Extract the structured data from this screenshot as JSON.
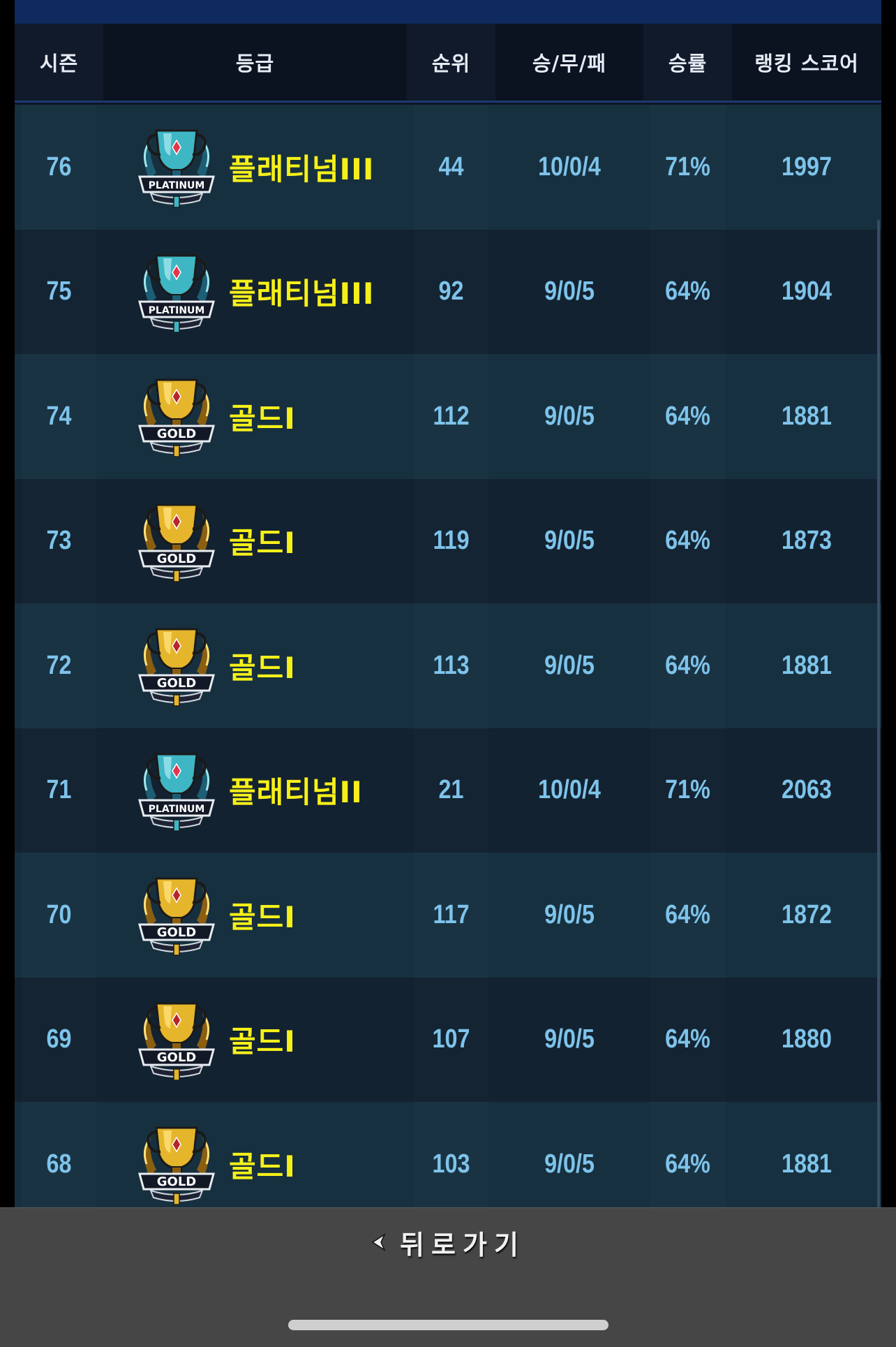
{
  "header": {
    "season": "시즌",
    "grade": "등급",
    "rank": "순위",
    "record": "승/무/패",
    "win_rate": "승률",
    "ranking_score": "랭킹 스코어"
  },
  "rows": [
    {
      "season": "76",
      "grade": "플래티넘III",
      "badge": "platinum",
      "rank": "44",
      "record": "10/0/4",
      "win_rate": "71%",
      "score": "1997"
    },
    {
      "season": "75",
      "grade": "플래티넘III",
      "badge": "platinum",
      "rank": "92",
      "record": "9/0/5",
      "win_rate": "64%",
      "score": "1904"
    },
    {
      "season": "74",
      "grade": "골드I",
      "badge": "gold",
      "rank": "112",
      "record": "9/0/5",
      "win_rate": "64%",
      "score": "1881"
    },
    {
      "season": "73",
      "grade": "골드I",
      "badge": "gold",
      "rank": "119",
      "record": "9/0/5",
      "win_rate": "64%",
      "score": "1873"
    },
    {
      "season": "72",
      "grade": "골드I",
      "badge": "gold",
      "rank": "113",
      "record": "9/0/5",
      "win_rate": "64%",
      "score": "1881"
    },
    {
      "season": "71",
      "grade": "플래티넘II",
      "badge": "platinum",
      "rank": "21",
      "record": "10/0/4",
      "win_rate": "71%",
      "score": "2063"
    },
    {
      "season": "70",
      "grade": "골드I",
      "badge": "gold",
      "rank": "117",
      "record": "9/0/5",
      "win_rate": "64%",
      "score": "1872"
    },
    {
      "season": "69",
      "grade": "골드I",
      "badge": "gold",
      "rank": "107",
      "record": "9/0/5",
      "win_rate": "64%",
      "score": "1880"
    },
    {
      "season": "68",
      "grade": "골드I",
      "badge": "gold",
      "rank": "103",
      "record": "9/0/5",
      "win_rate": "64%",
      "score": "1881"
    }
  ],
  "badges": {
    "platinum": {
      "text": "PLATINUM",
      "icon": "platinum-badge-icon",
      "main": "#3fb6c4",
      "dark": "#1d5e74",
      "light": "#9fe6ee",
      "gem": "#e5334b"
    },
    "gold": {
      "text": "GOLD",
      "icon": "gold-badge-icon",
      "main": "#e5b52c",
      "dark": "#8a5f12",
      "light": "#ffe27a",
      "gem": "#b8242e"
    }
  },
  "colors": {
    "grade_text": "#f6f01a",
    "value_text": "#7ec3ea",
    "header_text": "#e6ebf4",
    "bottom_bar": "#474646"
  },
  "footer": {
    "back_label": "뒤로가기",
    "back_icon": "chevron-left-icon"
  }
}
